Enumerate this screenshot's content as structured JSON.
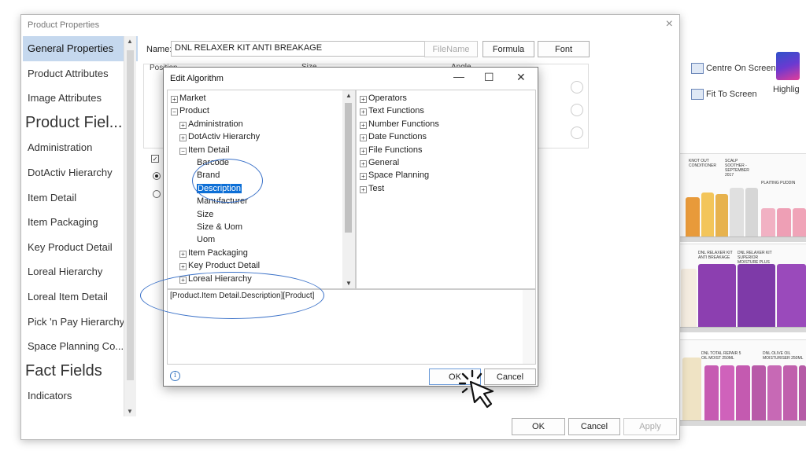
{
  "background": {
    "ribbon": {
      "centre_on_screen": "Centre On Screen",
      "fit_to_screen": "Fit To Screen",
      "highlight": "Highlig"
    },
    "shelf_labels": [
      "KNOT OUT CONDITIONER",
      "SCALP SOOTHER - SEPTEMBER 2017",
      "PLAITING PUDDIN",
      "DNL RELAXER KIT ANTI BREAKAGE",
      "DNL RELAXER KIT SUPERIOR MOISTURE PLUS",
      "DNL TOTAL REPAIR 5 OIL MOIST 250ML",
      "DNL OLIVE OIL MOISTURISER 250ML"
    ]
  },
  "product_properties": {
    "title": "Product Properties",
    "close": "×",
    "sidebar": [
      {
        "label": "General Properties",
        "type": "item",
        "selected": true
      },
      {
        "label": "Product Attributes",
        "type": "item"
      },
      {
        "label": "Image Attributes",
        "type": "item"
      },
      {
        "label": "Product Fiel...",
        "type": "header"
      },
      {
        "label": "Administration",
        "type": "item"
      },
      {
        "label": "DotActiv Hierarchy",
        "type": "item"
      },
      {
        "label": "Item Detail",
        "type": "item"
      },
      {
        "label": "Item Packaging",
        "type": "item"
      },
      {
        "label": "Key Product Detail",
        "type": "item"
      },
      {
        "label": "Loreal Hierarchy",
        "type": "item"
      },
      {
        "label": "Loreal Item Detail",
        "type": "item"
      },
      {
        "label": "Pick 'n Pay Hierarchy",
        "type": "item"
      },
      {
        "label": "Space Planning Co...",
        "type": "item"
      },
      {
        "label": "Fact Fields",
        "type": "header"
      },
      {
        "label": "Indicators",
        "type": "item"
      }
    ],
    "name_label": "Name:",
    "name_value": "DNL RELAXER KIT ANTI BREAKAGE",
    "filename_button": "FileName",
    "formula_button": "Formula",
    "font_button": "Font",
    "position_label": "Position",
    "size_label": "Size",
    "angle_label": "Angle",
    "ok_button": "OK",
    "cancel_button": "Cancel",
    "apply_button": "Apply"
  },
  "edit_algorithm": {
    "title": "Edit Algorithm",
    "minimize": "—",
    "maximize": "☐",
    "close": "✕",
    "tree": [
      {
        "label": "Market",
        "indent": 0,
        "expander": "+"
      },
      {
        "label": "Product",
        "indent": 0,
        "expander": "−"
      },
      {
        "label": "Administration",
        "indent": 1,
        "expander": "+"
      },
      {
        "label": "DotActiv Hierarchy",
        "indent": 1,
        "expander": "+"
      },
      {
        "label": "Item Detail",
        "indent": 1,
        "expander": "−"
      },
      {
        "label": "Barcode",
        "indent": 2,
        "expander": ""
      },
      {
        "label": "Brand",
        "indent": 2,
        "expander": ""
      },
      {
        "label": "Description",
        "indent": 2,
        "expander": "",
        "selected": true
      },
      {
        "label": "Manufacturer",
        "indent": 2,
        "expander": ""
      },
      {
        "label": "Size",
        "indent": 2,
        "expander": ""
      },
      {
        "label": "Size & Uom",
        "indent": 2,
        "expander": ""
      },
      {
        "label": "Uom",
        "indent": 2,
        "expander": ""
      },
      {
        "label": "Item Packaging",
        "indent": 1,
        "expander": "+"
      },
      {
        "label": "Key Product Detail",
        "indent": 1,
        "expander": "+"
      },
      {
        "label": "Loreal Hierarchy",
        "indent": 1,
        "expander": "+"
      }
    ],
    "functions": [
      "Operators",
      "Text Functions",
      "Number Functions",
      "Date Functions",
      "File Functions",
      "General",
      "Space Planning",
      "Test"
    ],
    "expression": "[Product.Item Detail.Description][Product]",
    "info": "i",
    "ok_button": "OK",
    "cancel_button": "Cancel"
  },
  "colors": {
    "selection": "#0d6fd6",
    "annotation": "#3a71c8",
    "sidebar_selected": "#c5d8ee"
  }
}
